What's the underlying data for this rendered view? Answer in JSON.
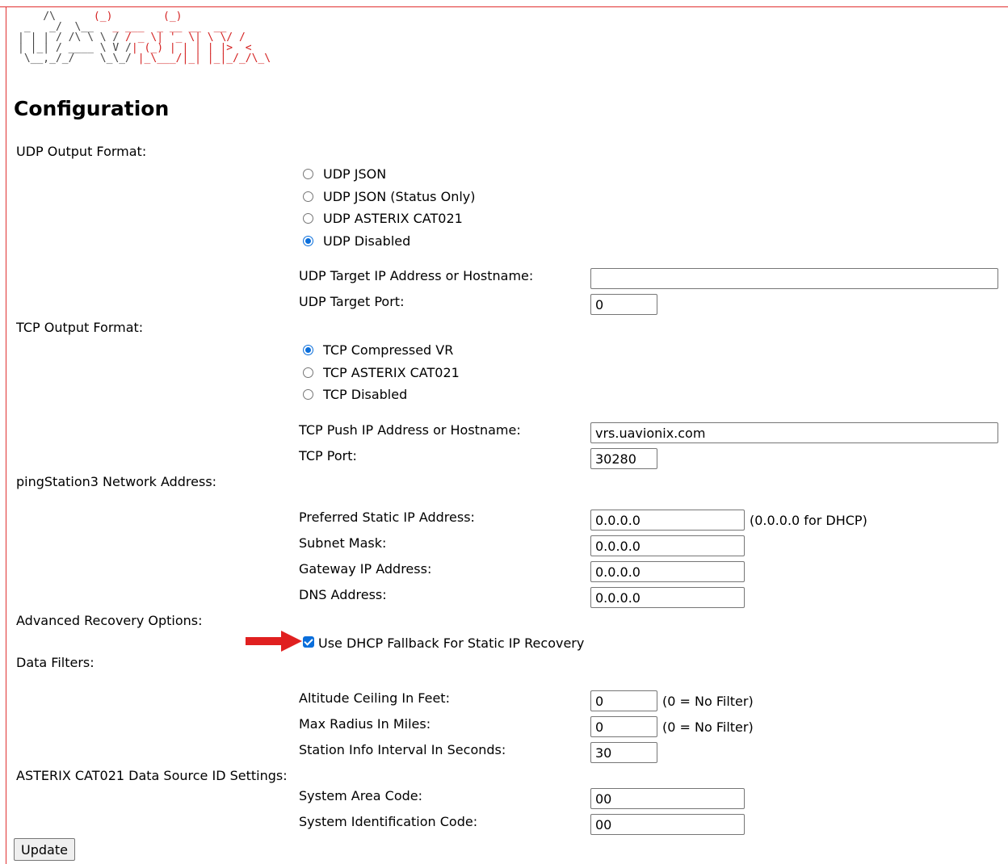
{
  "brand": {
    "logo_text": "uAvionix"
  },
  "page": {
    "title": "Configuration"
  },
  "udp": {
    "section_label": "UDP Output Format:",
    "options": [
      "UDP JSON",
      "UDP JSON (Status Only)",
      "UDP ASTERIX CAT021",
      "UDP Disabled"
    ],
    "selected": "UDP Disabled",
    "target_ip_label": "UDP Target IP Address or Hostname:",
    "target_ip_value": "",
    "target_port_label": "UDP Target Port:",
    "target_port_value": "0"
  },
  "tcp": {
    "section_label": "TCP Output Format:",
    "options": [
      "TCP Compressed VR",
      "TCP ASTERIX CAT021",
      "TCP Disabled"
    ],
    "selected": "TCP Compressed VR",
    "push_ip_label": "TCP Push IP Address or Hostname:",
    "push_ip_value": "vrs.uavionix.com",
    "port_label": "TCP Port:",
    "port_value": "30280"
  },
  "network": {
    "section_label": "pingStation3 Network Address:",
    "static_ip_label": "Preferred Static IP Address:",
    "static_ip_value": "0.0.0.0",
    "static_ip_hint": "(0.0.0.0 for DHCP)",
    "subnet_label": "Subnet Mask:",
    "subnet_value": "0.0.0.0",
    "gateway_label": "Gateway IP Address:",
    "gateway_value": "0.0.0.0",
    "dns_label": "DNS Address:",
    "dns_value": "0.0.0.0"
  },
  "recovery": {
    "section_label": "Advanced Recovery Options:",
    "dhcp_fallback_label": "Use DHCP Fallback For Static IP Recovery",
    "dhcp_fallback_checked": true
  },
  "filters": {
    "section_label": "Data Filters:",
    "altitude_label": "Altitude Ceiling In Feet:",
    "altitude_value": "0",
    "altitude_hint": "(0 = No Filter)",
    "radius_label": "Max Radius In Miles:",
    "radius_value": "0",
    "radius_hint": "(0 = No Filter)",
    "interval_label": "Station Info Interval In Seconds:",
    "interval_value": "30"
  },
  "asterix": {
    "section_label": "ASTERIX CAT021 Data Source ID Settings:",
    "area_code_label": "System Area Code:",
    "area_code_value": "00",
    "sys_id_label": "System Identification Code:",
    "sys_id_value": "00"
  },
  "actions": {
    "update_label": "Update"
  },
  "colors": {
    "accent": "#0a6edb",
    "annotation_arrow": "#e02020",
    "logo_red": "#d42020",
    "frame": "#e03030"
  }
}
